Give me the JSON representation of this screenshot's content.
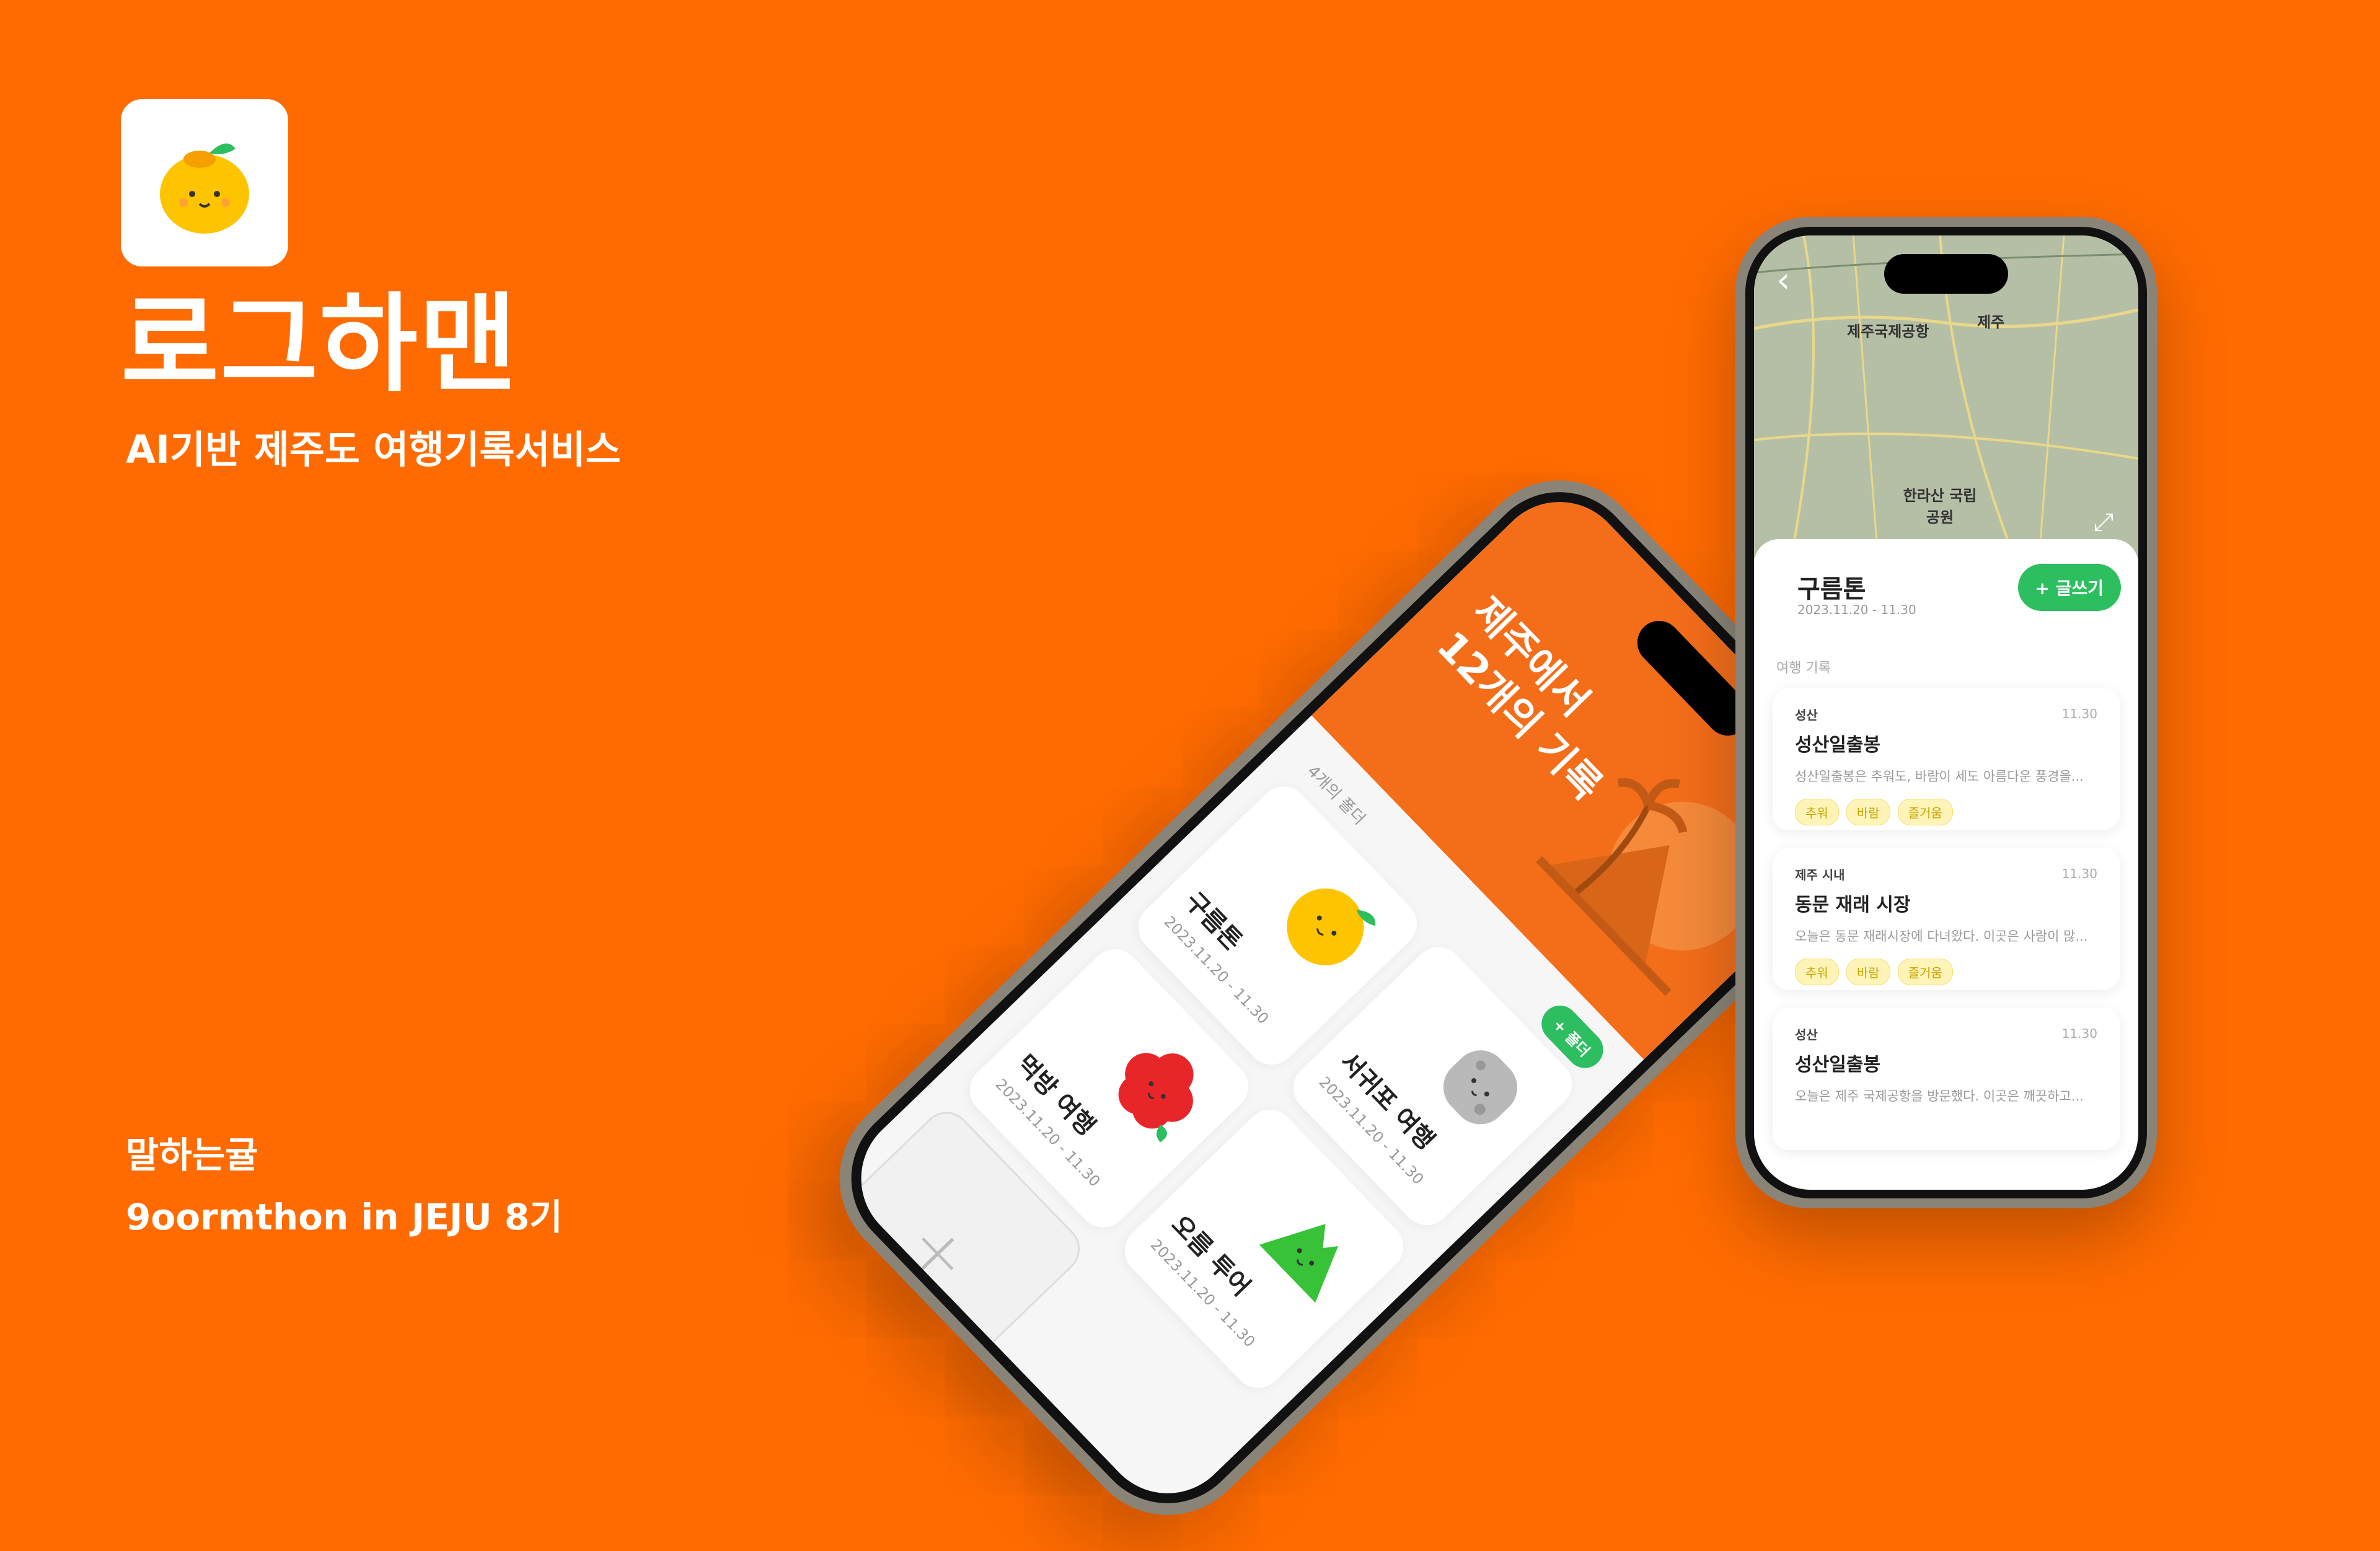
{
  "brand": {
    "title": "로그하맨",
    "subtitle": "AI기반 제주도 여행기록서비스",
    "team": "말하는귤",
    "event": "9oormthon in JEJU 8기"
  },
  "colors": {
    "background": "#FF6B00",
    "accent_green": "#2DBE60",
    "header_orange": "#F46E1A"
  },
  "phone_home": {
    "headline_line1": "제주에서",
    "headline_line2": "12개의 기록",
    "folder_count": "4개의 폴더",
    "add_folder_label": "+ 폴더",
    "add_card_symbol": "+",
    "folders": [
      {
        "name": "구름톤",
        "date": "2023.11.20 - 11.30",
        "icon": "tangerine-character-icon"
      },
      {
        "name": "서귀포 여행",
        "date": "2023.11.20 - 11.30",
        "icon": "rock-character-icon"
      },
      {
        "name": "먹방 여행",
        "date": "2023.11.20 - 11.30",
        "icon": "camellia-character-icon"
      },
      {
        "name": "오름 투어",
        "date": "2023.11.20 - 11.30",
        "icon": "oreum-character-icon"
      }
    ]
  },
  "phone_detail": {
    "map_labels": [
      "제주국제공항",
      "제주",
      "한라산 국립공원"
    ],
    "folder_title": "구름톤",
    "folder_date": "2023.11.20 - 11.30",
    "write_button": "+ 글쓰기",
    "section_label": "여행 기록",
    "records": [
      {
        "location": "성산",
        "date": "11.30",
        "title": "성산일출봉",
        "preview": "성산일출봉은 추워도, 바람이 세도 아름다운 풍경을...",
        "tags": [
          "추워",
          "바람",
          "즐거움"
        ]
      },
      {
        "location": "제주 시내",
        "date": "11.30",
        "title": "동문 재래 시장",
        "preview": "오늘은 동문 재래시장에 다녀왔다. 이곳은 사람이 많...",
        "tags": [
          "추워",
          "바람",
          "즐거움"
        ]
      },
      {
        "location": "성산",
        "date": "11.30",
        "title": "성산일출봉",
        "preview": "오늘은 제주 국제공항을 방문했다. 이곳은 깨끗하고...",
        "tags": []
      }
    ]
  }
}
